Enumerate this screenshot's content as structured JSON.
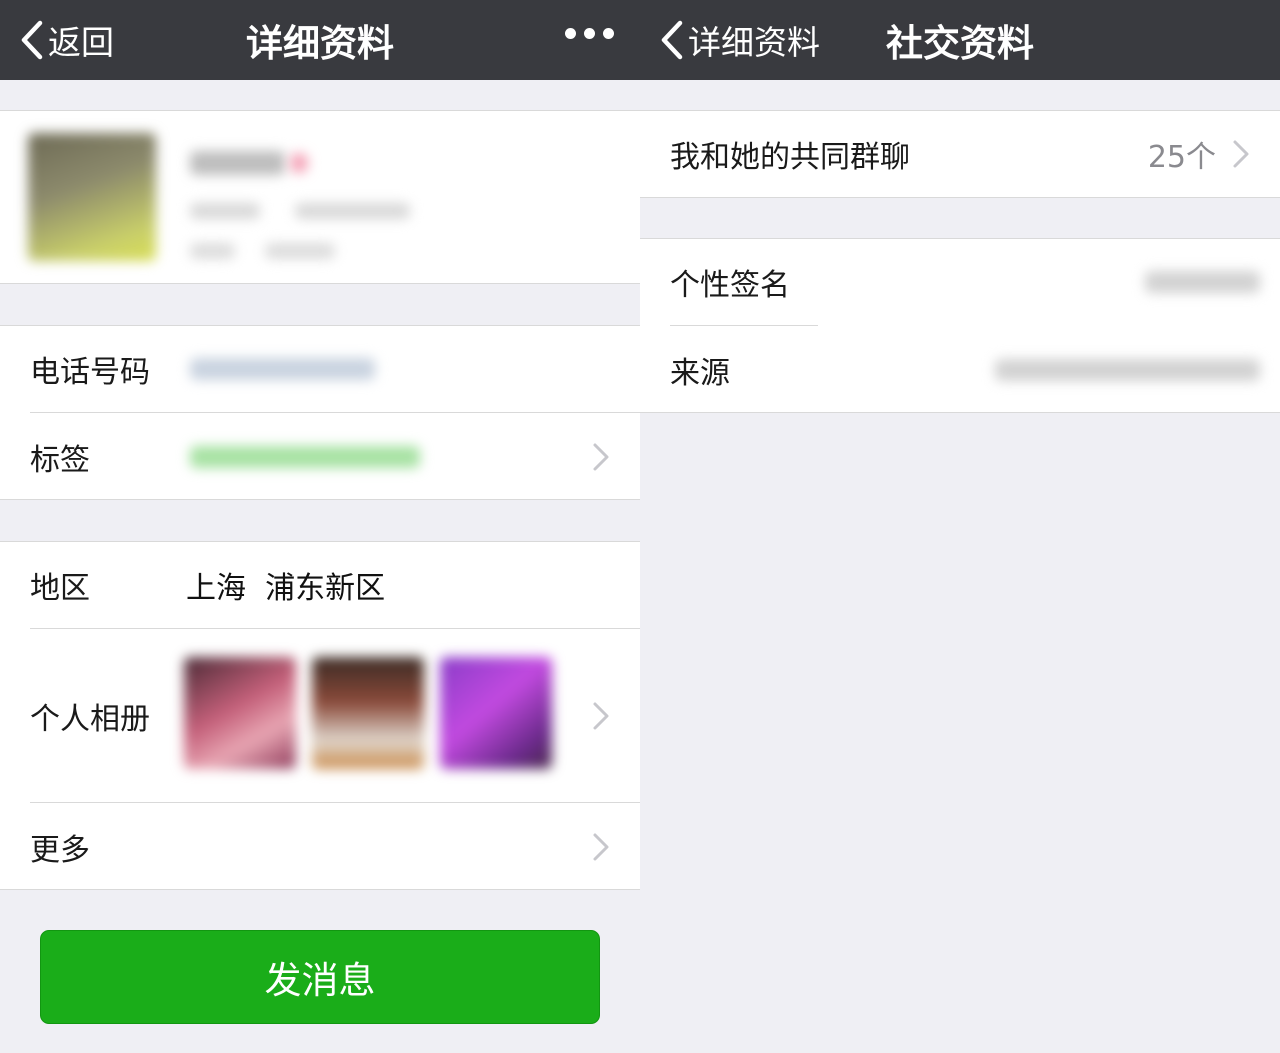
{
  "left": {
    "nav": {
      "back_label": "返回",
      "title": "详细资料"
    },
    "rows": {
      "phone_label": "电话号码",
      "tags_label": "标签",
      "region_label": "地区",
      "region_value": "上海  浦东新区",
      "album_label": "个人相册",
      "more_label": "更多"
    },
    "send_button": "发消息"
  },
  "right": {
    "nav": {
      "back_label": "详细资料",
      "title": "社交资料"
    },
    "rows": {
      "groups_label": "我和她的共同群聊",
      "groups_count": "25个",
      "signature_label": "个性签名",
      "source_label": "来源"
    }
  },
  "colors": {
    "navbar": "#393a3f",
    "background": "#efeff4",
    "accent_green": "#1aad19",
    "chevron": "#c7c7cc"
  },
  "icons": [
    "chevron-left-icon",
    "more-dots-icon",
    "chevron-right-icon"
  ]
}
